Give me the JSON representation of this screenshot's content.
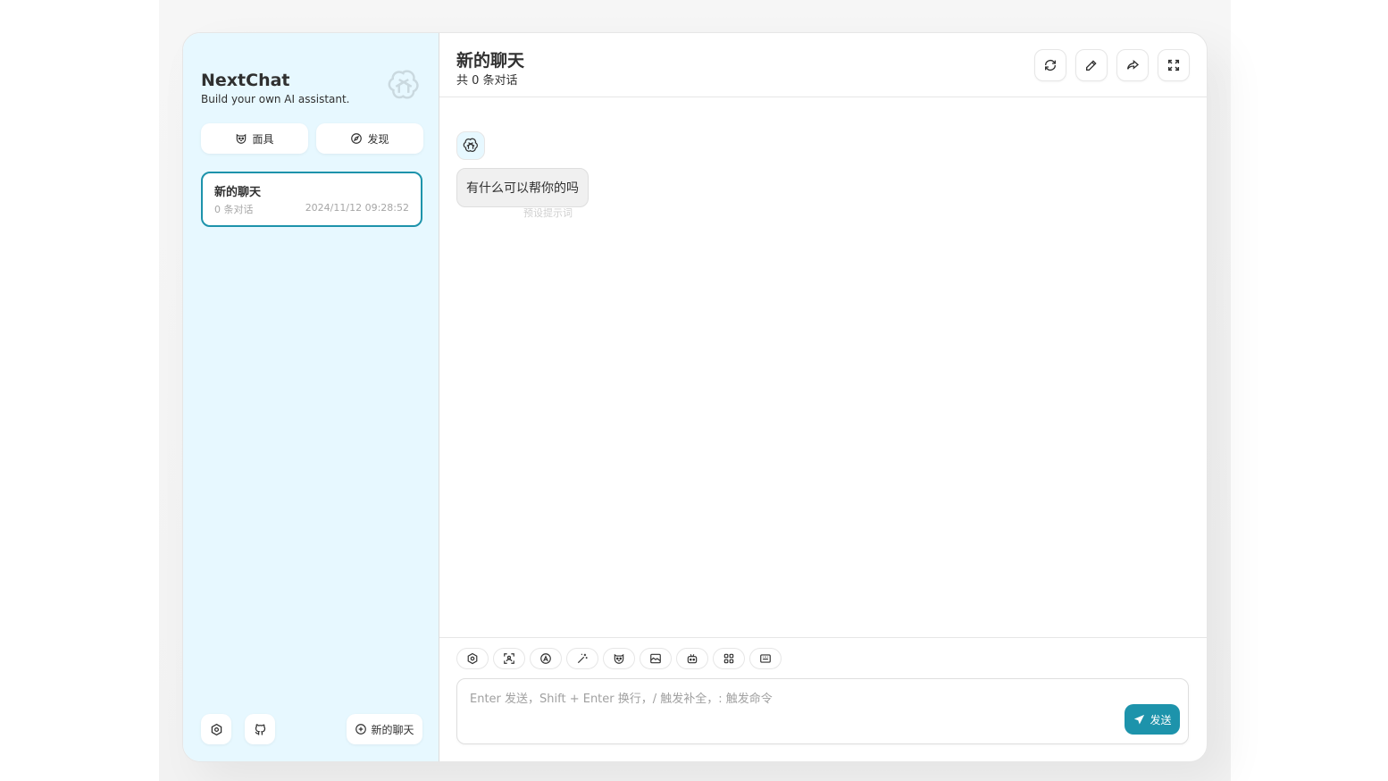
{
  "sidebar": {
    "title": "NextChat",
    "subtitle": "Build your own AI assistant.",
    "logo_icon": "openai-logo-icon",
    "mask_button": {
      "label": "面具",
      "icon": "mask-icon"
    },
    "discover_button": {
      "label": "发现",
      "icon": "discover-icon"
    },
    "chats": [
      {
        "title": "新的聊天",
        "count": "0 条对话",
        "time": "2024/11/12 09:28:52",
        "selected": true
      }
    ],
    "settings_icon": "settings-icon",
    "github_icon": "github-icon",
    "new_chat_button": {
      "label": "新的聊天",
      "icon": "add-icon"
    }
  },
  "header": {
    "title": "新的聊天",
    "subtitle": "共 0 条对话",
    "actions": [
      "reload-icon",
      "edit-icon",
      "share-icon",
      "fullscreen-icon"
    ]
  },
  "messages": [
    {
      "role": "assistant",
      "text": "有什么可以帮你的吗",
      "hint": "预设提示词"
    }
  ],
  "toolbar": [
    "settings-icon",
    "scan-icon",
    "model-icon",
    "magic-icon",
    "mask-icon",
    "image-icon",
    "robot-icon",
    "plugin-icon",
    "shortcut-icon"
  ],
  "input": {
    "placeholder": "Enter 发送，Shift + Enter 换行，/ 触发补全，: 触发命令",
    "value": "",
    "send_label": "发送"
  },
  "colors": {
    "accent": "#1d93ab",
    "sidebar_bg": "#e7f8ff"
  }
}
